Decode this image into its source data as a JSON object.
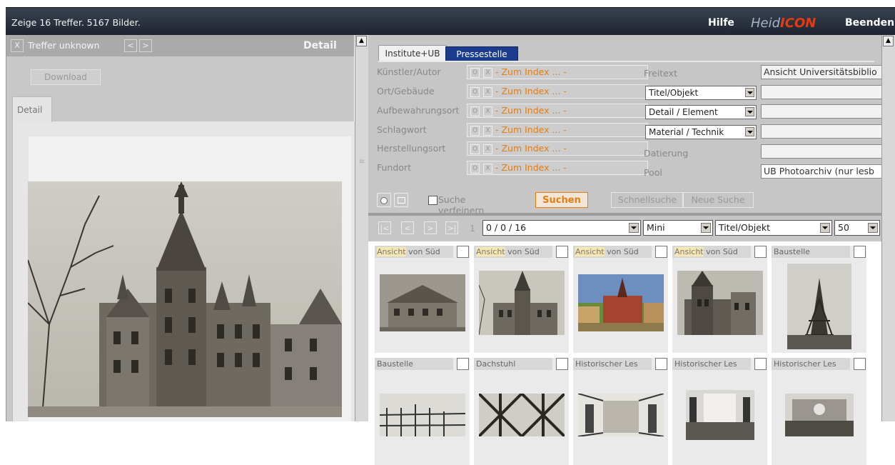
{
  "topbar": {
    "status": "Zeige 16 Treffer. 5167 Bilder.",
    "help": "Hilfe",
    "logo_a": "Heid",
    "logo_b": "ICON",
    "quit": "Beenden"
  },
  "detail": {
    "close": "X",
    "title": "Treffer unknown",
    "prev": "<",
    "next": ">",
    "heading": "Detail",
    "download": "Download",
    "tab": "Detail"
  },
  "search": {
    "tabs": [
      "Institute+UB",
      "Pressestelle"
    ],
    "fields": [
      {
        "label": "Künstler/Autor",
        "o": "O",
        "x": "X",
        "index": "- Zum Index ... -"
      },
      {
        "label": "Ort/Gebäude",
        "o": "O",
        "x": "X",
        "index": "- Zum Index ... -"
      },
      {
        "label": "Aufbewahrungsort",
        "o": "O",
        "x": "X",
        "index": "- Zum Index ... -"
      },
      {
        "label": "Schlagwort",
        "o": "O",
        "x": "X",
        "index": "- Zum Index ... -"
      },
      {
        "label": "Herstellungsort",
        "o": "O",
        "x": "X",
        "index": "- Zum Index ... -"
      },
      {
        "label": "Fundort",
        "o": "O",
        "x": "X",
        "index": "- Zum Index ... -"
      }
    ],
    "freitext_label": "Freitext",
    "freitext_value": "Ansicht Universitätsbiblio",
    "select1": "Titel/Objekt",
    "select2": "Detail / Element",
    "select3": "Material / Technik",
    "datierung_label": "Datierung",
    "pool_label": "Pool",
    "pool_value": "UB Photoarchiv (nur lesb",
    "refine": "Suche verfeinern",
    "search_btn": "Suchen",
    "quick_btn": "Schnellsuche",
    "new_btn": "Neue Suche"
  },
  "results": {
    "nav_first": "|<",
    "nav_prev": "<",
    "nav_next": ">",
    "nav_last": ">|",
    "page": "1",
    "range": "0 / 0 / 16",
    "view": "Mini",
    "sort": "Titel/Objekt",
    "per_page": "50",
    "items": [
      {
        "hl": "Ansicht",
        "rest": " von Süd",
        "kind": "house"
      },
      {
        "hl": "Ansicht",
        "rest": " von Süd",
        "kind": "library"
      },
      {
        "hl": "Ansicht",
        "rest": " von Süd",
        "kind": "color"
      },
      {
        "hl": "Ansicht",
        "rest": " von Süd",
        "kind": "library2"
      },
      {
        "hl": "",
        "rest": "Baustelle",
        "kind": "tower"
      },
      {
        "hl": "",
        "rest": "Baustelle",
        "kind": "scaffold"
      },
      {
        "hl": "",
        "rest": "Dachstuhl",
        "kind": "roof"
      },
      {
        "hl": "",
        "rest": "Historischer Les",
        "kind": "hall"
      },
      {
        "hl": "",
        "rest": "Historischer Les",
        "kind": "room"
      },
      {
        "hl": "",
        "rest": "Historischer Les",
        "kind": "room2"
      }
    ]
  }
}
